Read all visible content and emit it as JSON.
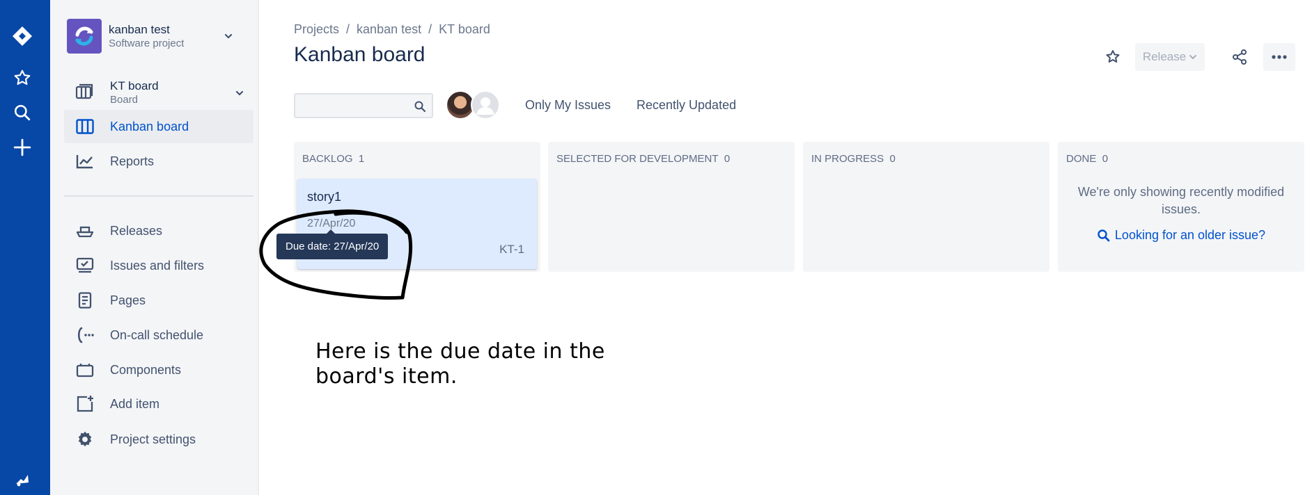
{
  "global_nav": {
    "items": [
      "jira-logo-icon",
      "star-icon",
      "search-icon",
      "create-icon"
    ],
    "bottom": "feedback-icon"
  },
  "sidebar": {
    "project": {
      "name": "kanban test",
      "type": "Software project"
    },
    "board": {
      "name": "KT board",
      "type": "Board"
    },
    "items": [
      {
        "label": "Kanban board",
        "icon": "board-columns-icon",
        "active": true
      },
      {
        "label": "Reports",
        "icon": "chart-icon"
      },
      {
        "label": "Releases",
        "icon": "ship-icon"
      },
      {
        "label": "Issues and filters",
        "icon": "issues-icon"
      },
      {
        "label": "Pages",
        "icon": "page-icon"
      },
      {
        "label": "On-call schedule",
        "icon": "phone-icon"
      },
      {
        "label": "Components",
        "icon": "component-icon"
      },
      {
        "label": "Add item",
        "icon": "add-item-icon"
      },
      {
        "label": "Project settings",
        "icon": "gear-icon"
      }
    ]
  },
  "header": {
    "breadcrumbs": [
      "Projects",
      "kanban test",
      "KT board"
    ],
    "separator": "/",
    "title": "Kanban board",
    "release_label": "Release"
  },
  "filters": {
    "search_placeholder": "",
    "only_my_issues": "Only My Issues",
    "recently_updated": "Recently Updated"
  },
  "columns": [
    {
      "title": "BACKLOG",
      "count": "1"
    },
    {
      "title": "SELECTED FOR DEVELOPMENT",
      "count": "0"
    },
    {
      "title": "IN PROGRESS",
      "count": "0"
    },
    {
      "title": "DONE",
      "count": "0"
    }
  ],
  "card": {
    "title": "story1",
    "due_date": "27/Apr/20",
    "key": "KT-1"
  },
  "done_column": {
    "message": "We're only showing recently modified issues.",
    "link": "Looking for an older issue?"
  },
  "tooltip": "Due date: 27/Apr/20",
  "annotation": "Here is the due date in the board's item.",
  "colors": {
    "global_nav": "#0747A6",
    "sidebar_bg": "#F4F5F7",
    "active_link": "#0052CC",
    "card_bg": "#DEEBFF",
    "tooltip_bg": "#253858"
  }
}
